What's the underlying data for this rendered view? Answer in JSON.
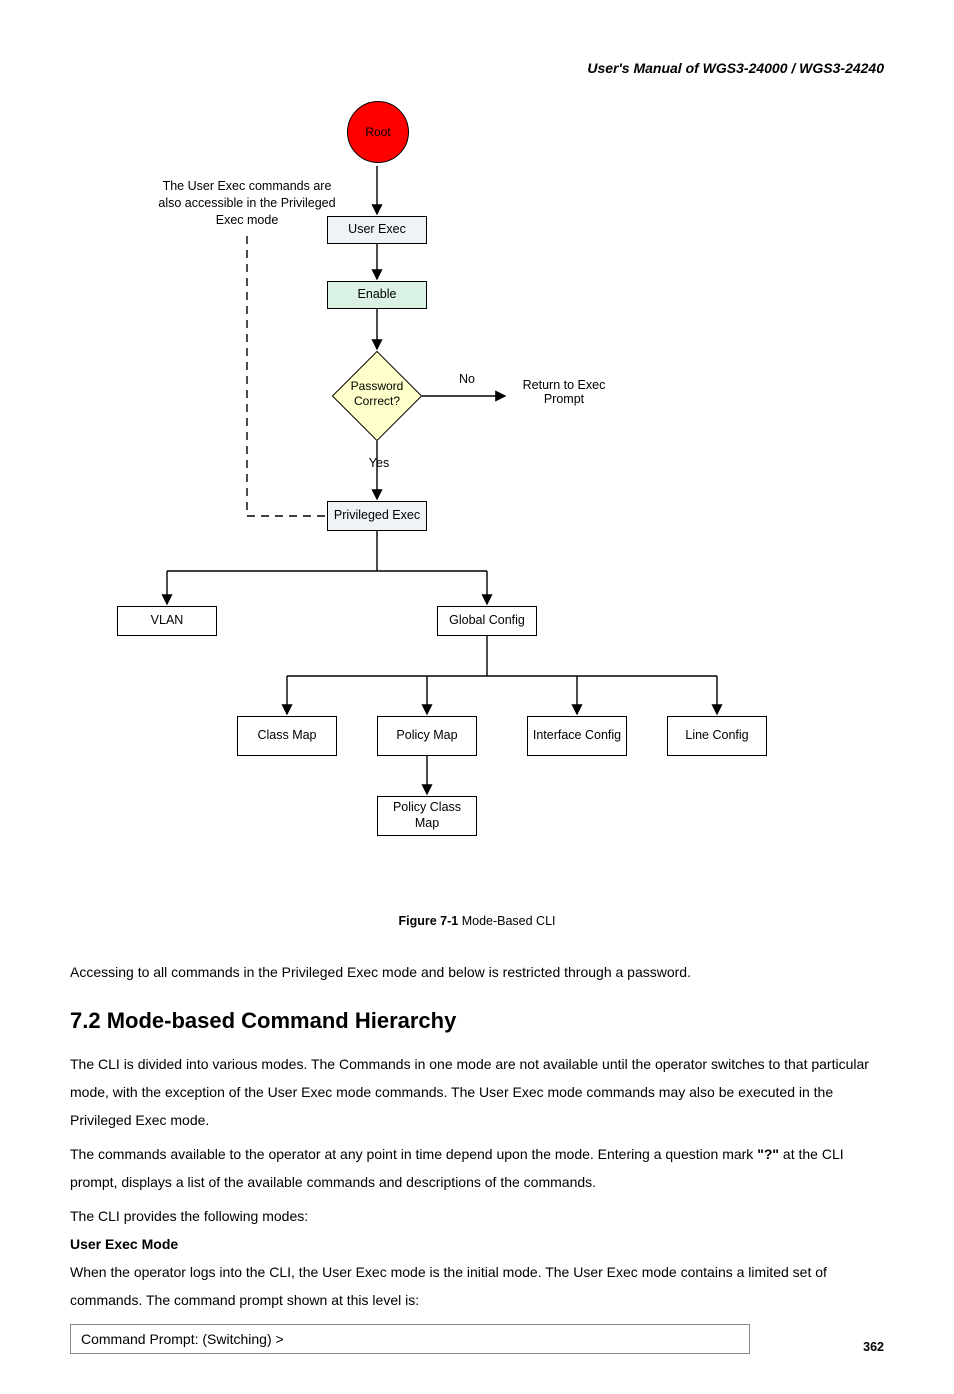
{
  "header": "User's  Manual  of  WGS3-24000  /  WGS3-24240",
  "diagram": {
    "sideNote": "The User Exec commands are also accessible in the Privileged Exec mode",
    "nodes": {
      "root": "Root",
      "userExec": "User Exec",
      "enable": "Enable",
      "password": "Password Correct?",
      "privExec": "Privileged Exec",
      "vlan": "VLAN",
      "globalConfig": "Global Config",
      "classMap": "Class Map",
      "policyMap": "Policy Map",
      "interfaceConfig": "Interface Config",
      "lineConfig": "Line Config",
      "policyClassMap": "Policy Class Map"
    },
    "labels": {
      "no": "No",
      "yes": "Yes",
      "returnPrompt": "Return to Exec Prompt"
    }
  },
  "figureCaption": {
    "bold": "Figure 7-1",
    "rest": " Mode-Based CLI"
  },
  "para1": "Accessing to all commands in the Privileged Exec mode and below is restricted through a password.",
  "sectionTitle": "7.2 Mode-based Command Hierarchy",
  "para2a": "The CLI is divided into various modes. The Commands in one mode are not available until the operator switches to that particular mode, with the exception of the User Exec mode commands. The User Exec mode commands may also be executed in the Privileged Exec mode.",
  "para2b_pre": "The commands available to the operator at any point in time depend upon the mode. Entering a question mark ",
  "para2b_q": "\"?\"",
  "para2b_post": " at the CLI prompt, displays a list of the available commands and descriptions of the commands.",
  "para2c": "The CLI provides the following modes:",
  "subhead": "User Exec Mode",
  "para3": "When the operator logs into the CLI, the User Exec mode is the initial mode. The User Exec mode contains a limited set of commands. The command prompt shown at this level is:",
  "cmdPrompt": "Command Prompt: (Switching) >",
  "pageNumber": "362"
}
